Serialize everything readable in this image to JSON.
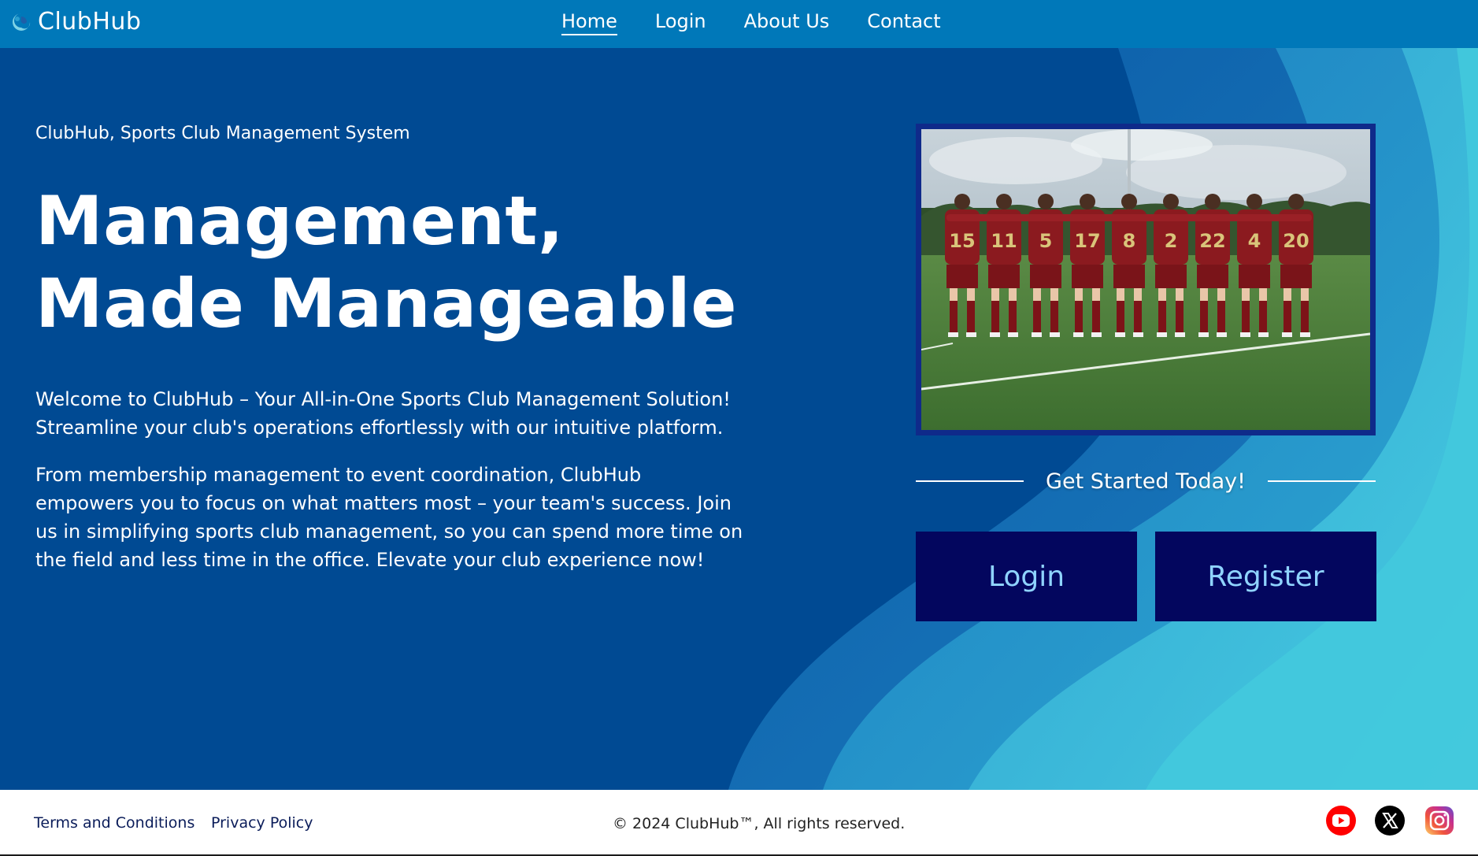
{
  "brand": {
    "name": "ClubHub"
  },
  "nav": {
    "items": [
      {
        "label": "Home",
        "active": true
      },
      {
        "label": "Login",
        "active": false
      },
      {
        "label": "About Us",
        "active": false
      },
      {
        "label": "Contact",
        "active": false
      }
    ]
  },
  "hero": {
    "subtitle": "ClubHub, Sports Club Management System",
    "headline_line1": "Management,",
    "headline_line2": "Made Manageable",
    "paragraph1": "Welcome to ClubHub – Your All-in-One Sports Club Management Solution! Streamline your club's operations effortlessly with our intuitive platform.",
    "paragraph2": "From membership management to event coordination, ClubHub empowers you to focus on what matters most – your team's success. Join us in simplifying sports club management, so you can spend more time on the field and less time in the office. Elevate your club experience now!",
    "photo_jersey_numbers": [
      "15",
      "11",
      "5",
      "17",
      "8",
      "2",
      "22",
      "4",
      "20"
    ]
  },
  "cta": {
    "heading": "Get Started Today!",
    "login_label": "Login",
    "register_label": "Register"
  },
  "footer": {
    "terms_label": "Terms and Conditions",
    "privacy_label": "Privacy Policy",
    "copyright": "© 2024 ClubHub™, All rights reserved.",
    "social": [
      "youtube-icon",
      "x-icon",
      "instagram-icon"
    ]
  },
  "colors": {
    "navbar": "#0078b9",
    "hero_bg": "#004a93",
    "button_bg": "#03065e",
    "button_text": "#8fd3ff",
    "wave_light": "#3fc9dc",
    "photo_frame": "#0f2a8a"
  }
}
